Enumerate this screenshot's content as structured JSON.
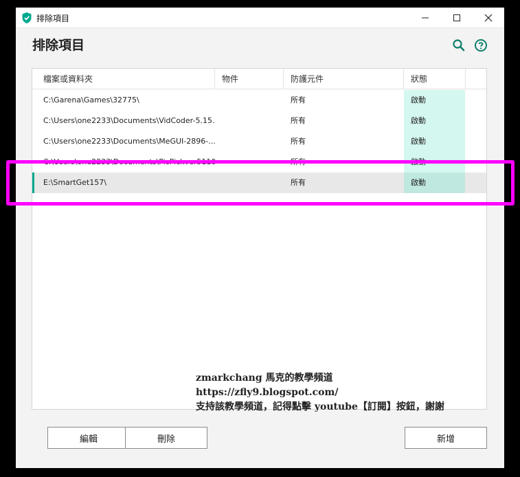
{
  "window": {
    "title": "排除項目"
  },
  "page": {
    "title": "排除項目"
  },
  "table": {
    "headers": [
      "檔案或資料夾",
      "物件",
      "防護元件",
      "狀態"
    ],
    "rows": [
      {
        "path": "C:\\Garena\\Games\\32775\\",
        "component": "所有",
        "status": "啟動"
      },
      {
        "path": "C:\\Users\\one2233\\Documents\\VidCoder-5.15...",
        "component": "所有",
        "status": "啟動"
      },
      {
        "path": "C:\\Users\\one2233\\Documents\\MeGUI-2896-...",
        "component": "所有",
        "status": "啟動"
      },
      {
        "path": "C:\\Users\\one2233\\Documents\\PicPickver5110\\",
        "component": "所有",
        "status": "啟動"
      },
      {
        "path": "E:\\SmartGet157\\",
        "component": "所有",
        "status": "啟動"
      }
    ]
  },
  "watermark": {
    "line1": "zmarkchang 馬克的教學頻道",
    "line2": "https://zfly9.blogspot.com/",
    "line3": "支持該教學頻道，記得點擊 youtube【訂閱】按鈕，謝謝"
  },
  "buttons": {
    "edit": "編輯",
    "delete": "刪除",
    "add": "新增"
  },
  "colors": {
    "accent": "#00a88e",
    "highlight": "#ff00ff",
    "status_bg": "#d4f7f0"
  }
}
